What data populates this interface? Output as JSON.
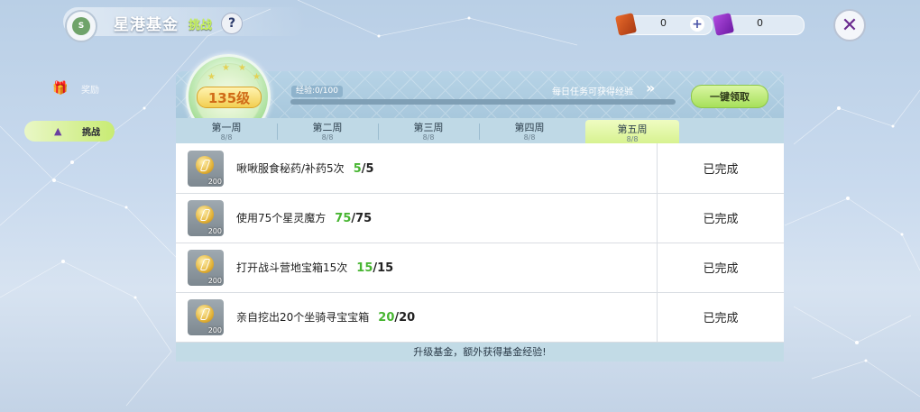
{
  "header": {
    "logo_text": "S",
    "title": "星港基金",
    "subtitle": "挑战",
    "help_label": "?"
  },
  "currencies": [
    {
      "icon": "orange-ticket-icon",
      "value": "0",
      "color": "#d9581c"
    },
    {
      "icon": "purple-ticket-icon",
      "value": "0",
      "color": "#8b2fc9"
    }
  ],
  "plus_label": "+",
  "close_label": "✕",
  "sidebar": {
    "items": [
      {
        "label": "奖励",
        "icon": "gift-icon",
        "active": false
      },
      {
        "label": "挑战",
        "icon": "trophy-icon",
        "active": true
      }
    ]
  },
  "level": {
    "label": "135级"
  },
  "exp": {
    "label": "经验:0/100",
    "progress": 0
  },
  "daily_hint": "每日任务可获得经验",
  "claim_all": "一键领取",
  "tabs": [
    {
      "label": "第一周",
      "sub": "8/8"
    },
    {
      "label": "第二周",
      "sub": "8/8"
    },
    {
      "label": "第三周",
      "sub": "8/8"
    },
    {
      "label": "第四周",
      "sub": "8/8"
    },
    {
      "label": "第五周",
      "sub": "8/8",
      "active": true
    }
  ],
  "tasks": [
    {
      "text": "啾啾服食秘药/补药5次",
      "cur": "5",
      "total": "/5",
      "reward": "200",
      "status": "已完成"
    },
    {
      "text": "使用75个星灵魔方",
      "cur": "75",
      "total": "/75",
      "reward": "200",
      "status": "已完成"
    },
    {
      "text": "打开战斗营地宝箱15次",
      "cur": "15",
      "total": "/15",
      "reward": "200",
      "status": "已完成"
    },
    {
      "text": "亲自挖出20个坐骑寻宝宝箱",
      "cur": "20",
      "total": "/20",
      "reward": "200",
      "status": "已完成"
    }
  ],
  "footer": "升级基金，额外获得基金经验!",
  "colors": {
    "accent_green": "#47b531",
    "tab_active": "#d7f290",
    "level_text": "#d06b18"
  }
}
